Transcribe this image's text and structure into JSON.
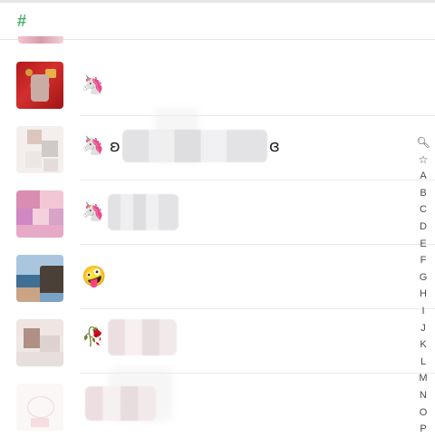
{
  "section": {
    "letter": "#"
  },
  "contacts": [
    {
      "emoji": "🦄",
      "prefix": "",
      "suffix": ""
    },
    {
      "emoji": "🦄",
      "prefix": "ʚ",
      "suffix": "ɞ"
    },
    {
      "emoji": "🦄",
      "prefix": "",
      "suffix": ""
    },
    {
      "emoji": "🤪",
      "prefix": "",
      "suffix": ""
    },
    {
      "emoji": "🥀",
      "prefix": "",
      "suffix": ""
    },
    {
      "emoji": "",
      "prefix": "",
      "suffix": ""
    }
  ],
  "index_bar": {
    "search_glyph": "🔍︎",
    "star_glyph": "☆",
    "letters": [
      "A",
      "B",
      "C",
      "D",
      "E",
      "F",
      "G",
      "H",
      "I",
      "J",
      "K",
      "L",
      "M",
      "N",
      "O",
      "P"
    ]
  }
}
